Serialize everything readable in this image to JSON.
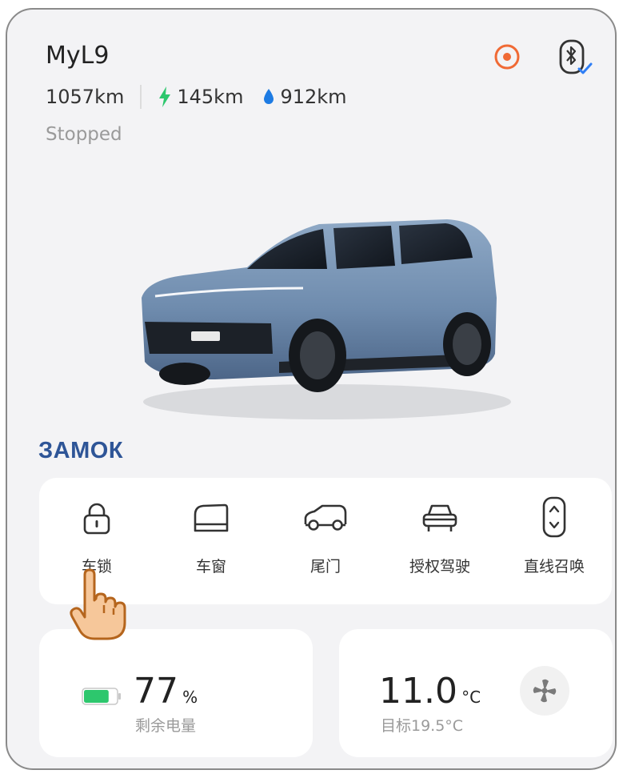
{
  "vehicle": {
    "name": "MyL9",
    "total_range": "1057km",
    "electric_range": "145km",
    "fuel_range": "912km",
    "status": "Stopped"
  },
  "header_icons": [
    "location-target-icon",
    "bluetooth-key-icon"
  ],
  "annotation": {
    "label": "ЗАМОК"
  },
  "controls": [
    {
      "label": "车锁",
      "icon": "lock-icon"
    },
    {
      "label": "车窗",
      "icon": "window-icon"
    },
    {
      "label": "尾门",
      "icon": "tailgate-icon"
    },
    {
      "label": "授权驾驶",
      "icon": "authorized-driving-icon"
    },
    {
      "label": "直线召唤",
      "icon": "straight-summon-icon"
    }
  ],
  "battery": {
    "value": "77",
    "unit": "%",
    "label": "剩余电量",
    "level": 0.77
  },
  "climate": {
    "value": "11.0",
    "unit": "°C",
    "target": "目标19.5°C"
  },
  "colors": {
    "accent_orange": "#f06a35",
    "bluetooth_check": "#2f7ef5",
    "electric_green": "#2dc76d",
    "fuel_blue": "#1d7be3",
    "annotation_blue": "#2e5597"
  }
}
